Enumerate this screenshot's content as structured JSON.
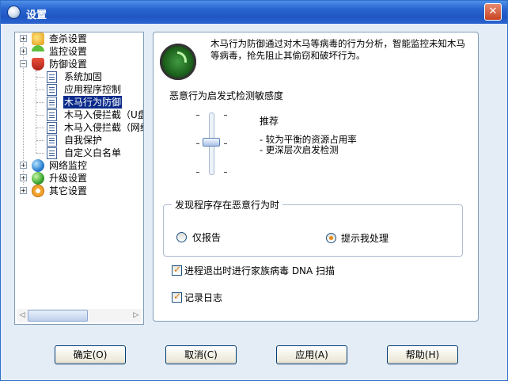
{
  "window": {
    "title": "设置",
    "close_glyph": "✕"
  },
  "tree": {
    "items": [
      {
        "label": "查杀设置",
        "icon": "scan-icon",
        "expander": "+"
      },
      {
        "label": "监控设置",
        "icon": "umbrella-icon",
        "expander": "+"
      },
      {
        "label": "防御设置",
        "icon": "shield-icon",
        "expander": "−"
      },
      {
        "label": "系统加固",
        "icon": "doc-icon"
      },
      {
        "label": "应用程序控制",
        "icon": "doc-icon"
      },
      {
        "label": "木马行为防御",
        "icon": "doc-icon",
        "selected": true
      },
      {
        "label": "木马入侵拦截（U盘",
        "icon": "doc-icon"
      },
      {
        "label": "木马入侵拦截（网络",
        "icon": "doc-icon"
      },
      {
        "label": "自我保护",
        "icon": "doc-icon"
      },
      {
        "label": "自定义白名单",
        "icon": "doc-icon"
      },
      {
        "label": "网络监控",
        "icon": "globe-icon",
        "expander": "+"
      },
      {
        "label": "升级设置",
        "icon": "upgrade-icon",
        "expander": "+"
      },
      {
        "label": "其它设置",
        "icon": "gear-icon",
        "expander": "+"
      }
    ]
  },
  "panel": {
    "description": "木马行为防御通过对木马等病毒的行为分析，智能监控未知木马等病毒，抢先阻止其偷窃和破坏行为。",
    "sensitivity_title": "恶意行为启发式检测敏感度",
    "sensitivity_level": 0.5,
    "level_title": "推荐",
    "level_desc_1": "- 较为平衡的资源占用率",
    "level_desc_2": "- 更深层次启发检测",
    "group_title": "发现程序存在恶意行为时",
    "radio_report": "仅报告",
    "radio_prompt": "提示我处理",
    "selected_radio": "提示我处理",
    "checkbox_dna": "进程退出时进行家族病毒 DNA 扫描",
    "checkbox_dna_checked": true,
    "checkbox_log": "记录日志",
    "checkbox_log_checked": true
  },
  "buttons": {
    "ok": "确定(O)",
    "cancel": "取消(C)",
    "apply": "应用(A)",
    "help": "帮助(H)"
  },
  "colors": {
    "titlebar": "#2a66d0",
    "selection": "#0a2a8a",
    "accent_check": "#d47a14"
  }
}
